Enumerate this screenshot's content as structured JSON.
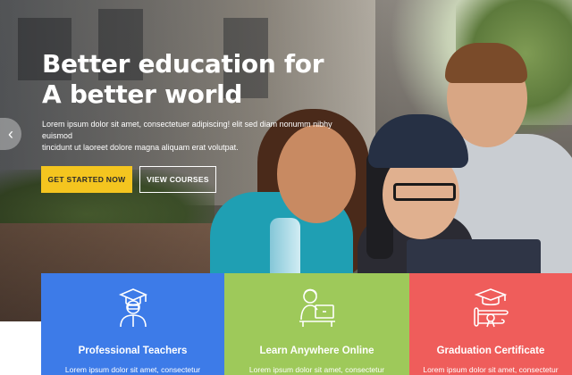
{
  "hero": {
    "headline_line1": "Better education for",
    "headline_line2": "A better world",
    "intro_line1": "Lorem ipsum dolor sit amet, consectetuer adipiscing! elit sed diam nonumm nibhy euismod",
    "intro_line2": "tincidunt ut laoreet dolore magna aliquam erat volutpat.",
    "primary_button": "GET STARTED NOW",
    "secondary_button": "VIEW COURSES",
    "prev_arrow": "‹"
  },
  "features": [
    {
      "title": "Professional Teachers",
      "text": "Lorem ipsum dolor sit amet, consectetur",
      "color": "#3d7be8",
      "icon": "teacher-icon"
    },
    {
      "title": "Learn Anywhere Online",
      "text": "Lorem ipsum dolor sit amet, consectetur",
      "color": "#9ec95a",
      "icon": "online-learning-icon"
    },
    {
      "title": "Graduation Certificate",
      "text": "Lorem ipsum dolor sit amet, consectetur",
      "color": "#ef5d5b",
      "icon": "certificate-icon"
    }
  ],
  "colors": {
    "accent_yellow": "#f4c51f",
    "white": "#ffffff"
  }
}
